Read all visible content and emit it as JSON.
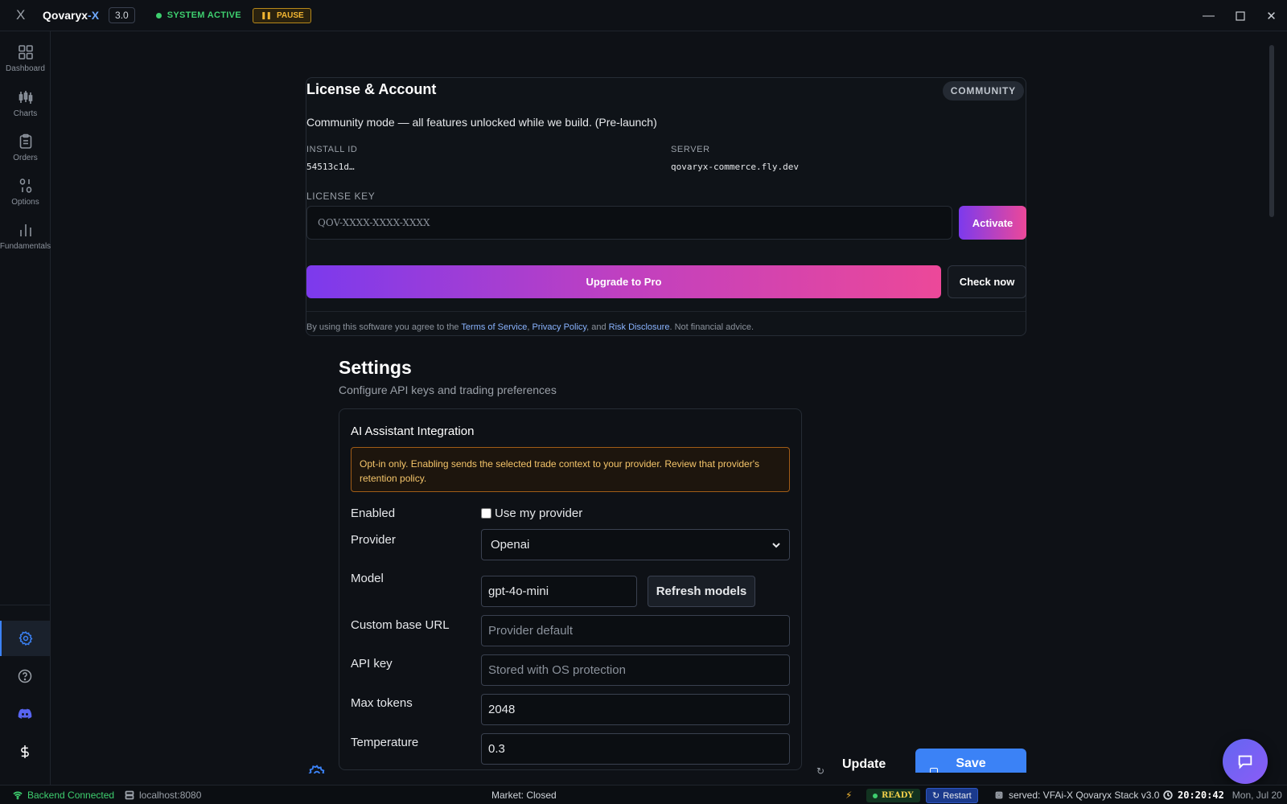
{
  "titlebar": {
    "logo": "X",
    "app_name": "Qovaryx",
    "app_name_accent": "-X",
    "version": "3.0",
    "status": "SYSTEM ACTIVE",
    "pause_label": "PAUSE",
    "minimize_icon": "minimize-icon",
    "maximize_icon": "maximize-icon",
    "close_icon": "close-icon"
  },
  "sidebar": {
    "items": [
      {
        "label": "Dashboard",
        "icon": "dashboard-icon"
      },
      {
        "label": "Charts",
        "icon": "charts-icon"
      },
      {
        "label": "Orders",
        "icon": "orders-icon"
      },
      {
        "label": "Options",
        "icon": "options-icon"
      },
      {
        "label": "Fundamentals",
        "icon": "fundamentals-icon"
      }
    ],
    "bottom": [
      "settings-icon",
      "help-icon",
      "discord-icon",
      "dollar-icon"
    ]
  },
  "license": {
    "title": "License & Account",
    "badge": "COMMUNITY",
    "description": "Community mode — all features unlocked while we build. (Pre-launch)",
    "install_id_label": "INSTALL ID",
    "install_id_value": "54513c1d…",
    "server_label": "SERVER",
    "server_value": "qovaryx-commerce.fly.dev",
    "key_label": "LICENSE KEY",
    "key_placeholder": "QOV-XXXX-XXXX-XXXX",
    "activate_label": "Activate",
    "upgrade_label": "Upgrade to Pro",
    "check_label": "Check now",
    "legal_prefix": "By using this software you agree to the ",
    "terms_link": "Terms of Service",
    "comma": ", ",
    "privacy_link": "Privacy Policy",
    "and": ", and ",
    "risk_link": "Risk Disclosure",
    "legal_suffix": ". Not financial advice."
  },
  "settings": {
    "title": "Settings",
    "subtitle": "Configure API keys and trading preferences",
    "ai": {
      "title": "AI Assistant Integration",
      "warning": "Opt-in only. Enabling sends the selected trade context to your provider. Review that provider's retention policy.",
      "enabled_label": "Enabled",
      "checkbox_label": "Use my provider",
      "provider_label": "Provider",
      "provider_value": "Openai",
      "model_label": "Model",
      "model_value": "gpt-4o-mini",
      "refresh_label": "Refresh models",
      "base_url_label": "Custom base URL",
      "base_url_placeholder": "Provider default",
      "api_key_label": "API key",
      "api_key_placeholder": "Stored with OS protection",
      "max_tokens_label": "Max tokens",
      "max_tokens_value": "2048",
      "temperature_label": "Temperature",
      "temperature_value": "0.3"
    },
    "update_label": "Update",
    "save_label": "Save"
  },
  "statusbar": {
    "connection": "Backend Connected",
    "host": "localhost:8080",
    "market": "Market: Closed",
    "ready": "READY",
    "restart": "Restart",
    "served": "served: VFAi-X Qovaryx Stack v3.0",
    "time": "20:20:42",
    "date": "Mon, Jul 20"
  },
  "colors": {
    "accent": "#3b82f6",
    "gradient_start": "#7c3aed",
    "gradient_end": "#ec4899",
    "status_green": "#3ecf6f",
    "warning": "#f2b632"
  }
}
